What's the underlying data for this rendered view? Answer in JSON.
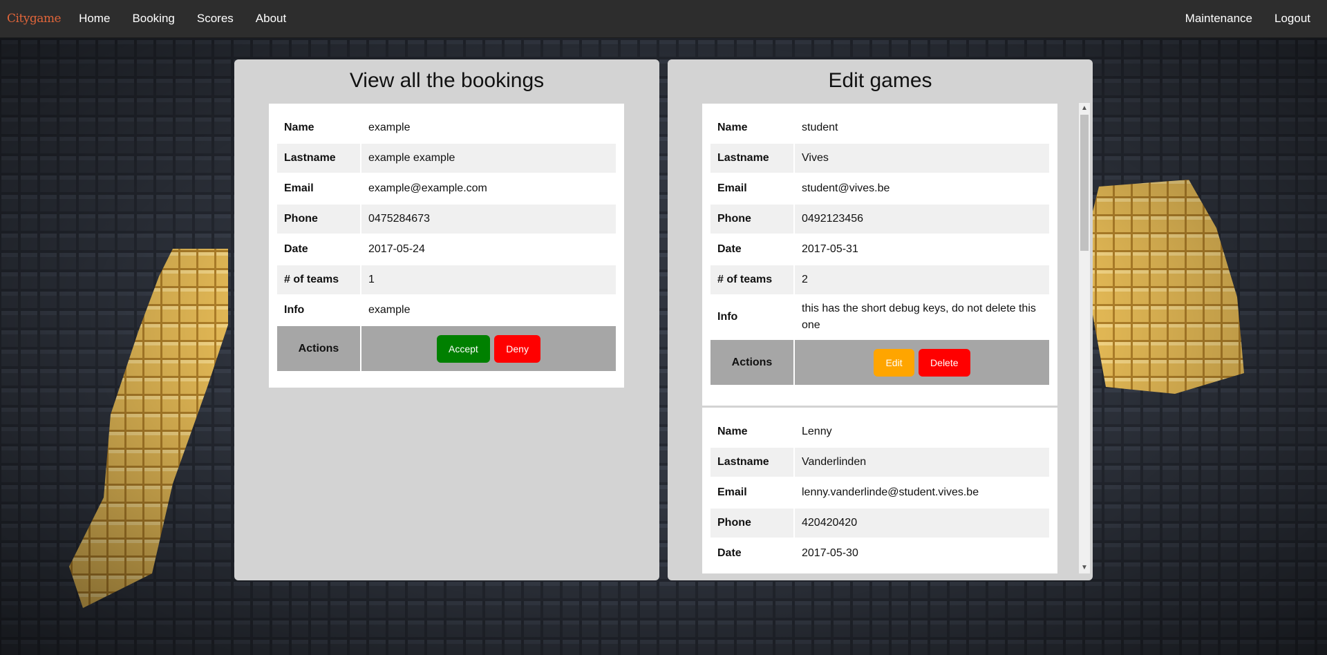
{
  "navbar": {
    "brand": "Citygame",
    "links": [
      "Home",
      "Booking",
      "Scores",
      "About"
    ],
    "right_links": [
      "Maintenance",
      "Logout"
    ]
  },
  "bookings_panel": {
    "title": "View all the bookings",
    "booking": {
      "rows": [
        {
          "label": "Name",
          "value": "example"
        },
        {
          "label": "Lastname",
          "value": "example example"
        },
        {
          "label": "Email",
          "value": "example@example.com"
        },
        {
          "label": "Phone",
          "value": "0475284673"
        },
        {
          "label": "Date",
          "value": "2017-05-24"
        },
        {
          "label": "# of teams",
          "value": "1"
        },
        {
          "label": "Info",
          "value": "example"
        }
      ],
      "actions_label": "Actions",
      "accept_label": "Accept",
      "deny_label": "Deny"
    }
  },
  "games_panel": {
    "title": "Edit games",
    "games": [
      {
        "rows": [
          {
            "label": "Name",
            "value": "student"
          },
          {
            "label": "Lastname",
            "value": "Vives"
          },
          {
            "label": "Email",
            "value": "student@vives.be"
          },
          {
            "label": "Phone",
            "value": "0492123456"
          },
          {
            "label": "Date",
            "value": "2017-05-31"
          },
          {
            "label": "# of teams",
            "value": "2"
          },
          {
            "label": "Info",
            "value": "this has the short debug keys, do not delete this one"
          }
        ],
        "actions_label": "Actions",
        "edit_label": "Edit",
        "delete_label": "Delete"
      },
      {
        "rows": [
          {
            "label": "Name",
            "value": "Lenny"
          },
          {
            "label": "Lastname",
            "value": "Vanderlinden"
          },
          {
            "label": "Email",
            "value": "lenny.vanderlinde@student.vives.be"
          },
          {
            "label": "Phone",
            "value": "420420420"
          },
          {
            "label": "Date",
            "value": "2017-05-30"
          }
        ]
      }
    ]
  },
  "colors": {
    "navbar": "#2d2d2d",
    "brand": "#e0653a",
    "panel": "#d3d3d3",
    "accept": "#008000",
    "deny": "#ff0000",
    "edit": "#ffa500",
    "delete": "#ff0000",
    "actions_row": "#a6a6a6"
  }
}
